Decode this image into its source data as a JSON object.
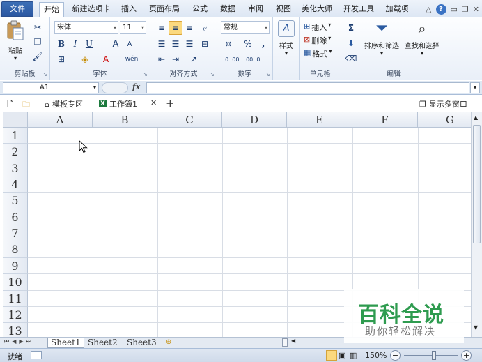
{
  "ribbon_tabs": {
    "file": "文件",
    "home": "开始",
    "new_tab": "新建选项卡",
    "insert": "插入",
    "page_layout": "页面布局",
    "formulas": "公式",
    "data": "数据",
    "review": "审阅",
    "view": "视图",
    "beautify": "美化大师",
    "developer": "开发工具",
    "addins": "加载项"
  },
  "clipboard": {
    "paste": "粘贴",
    "label": "剪贴板"
  },
  "font": {
    "name": "宋体",
    "size": "11",
    "label": "字体",
    "bold": "B",
    "italic": "I",
    "underline": "U",
    "grow": "A",
    "shrink": "A",
    "phonetic": "wén"
  },
  "alignment": {
    "label": "对齐方式"
  },
  "number": {
    "format": "常规",
    "label": "数字",
    "percent": "%",
    "comma": ",",
    "inc_decimal": ".0 .00",
    "dec_decimal": ".00 .0"
  },
  "styles": {
    "label": "样式"
  },
  "cells": {
    "insert": "插入",
    "delete": "删除",
    "format": "格式",
    "label": "单元格"
  },
  "editing": {
    "sum": "Σ",
    "sort_filter": "排序和筛选",
    "find_select": "查找和选择",
    "label": "编辑"
  },
  "formula_bar": {
    "name_box": "A1",
    "fx": "fx",
    "formula": ""
  },
  "doc_tabs": {
    "template": "模板专区",
    "workbook": "工作簿1",
    "close": "✕",
    "add": "+",
    "multi_window": "显示多窗口"
  },
  "columns": [
    "A",
    "B",
    "C",
    "D",
    "E",
    "F",
    "G"
  ],
  "rows": [
    "1",
    "2",
    "3",
    "4",
    "5",
    "6",
    "7",
    "8",
    "9",
    "10",
    "11",
    "12",
    "13"
  ],
  "sheets": [
    "Sheet1",
    "Sheet2",
    "Sheet3"
  ],
  "status": {
    "mode": "就绪",
    "zoom": "150%",
    "zoom_minus": "−",
    "zoom_plus": "+"
  },
  "watermark": {
    "title": "百科全说",
    "subtitle": "助你轻松解决"
  },
  "colors": {
    "file_tab": "#2a57a1",
    "selected_button": "#fbd97f",
    "watermark_green": "#2e9b4f"
  }
}
